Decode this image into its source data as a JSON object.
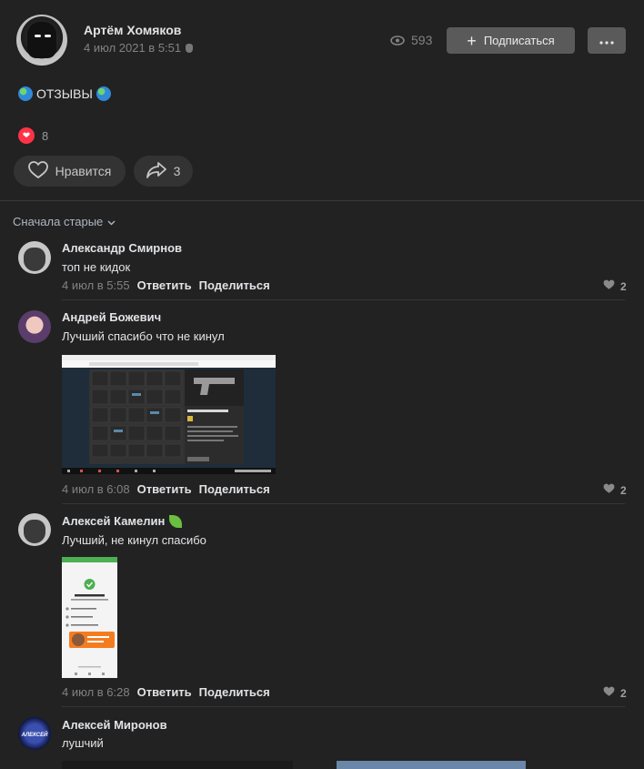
{
  "post": {
    "author": "Артём Хомяков",
    "date": "4 июл 2021 в 5:51",
    "views": "593",
    "subscribe_label": "Подписаться",
    "text": "ОТЗЫВЫ",
    "reactions_count": "8",
    "like_label": "Нравится",
    "shares_count": "3"
  },
  "comments_header": {
    "sort_label": "Сначала старые"
  },
  "comments": [
    {
      "author": "Александр Смирнов",
      "text": "топ не кидок",
      "time": "4 июл в 5:55",
      "reply": "Ответить",
      "share": "Поделиться",
      "likes": "2"
    },
    {
      "author": "Андрей Божевич",
      "text": "Лучший спасибо что не кинул",
      "time": "4 июл в 6:08",
      "reply": "Ответить",
      "share": "Поделиться",
      "likes": "2",
      "image_texts": {
        "item_title": "Desert Eagle | Mecenaj",
        "button": "Продать"
      }
    },
    {
      "author": "Алексей Камелин",
      "text": "Лучший, не кинул спасибо",
      "time": "4 июл в 6:28",
      "reply": "Ответить",
      "share": "Поделиться",
      "likes": "2",
      "image_texts": {
        "title": "Оплата отправлена"
      }
    },
    {
      "author": "Алексей Миронов",
      "text": "лушчий",
      "avatar_text": "АЛЕКСЕЙ"
    }
  ],
  "colors": {
    "background": "#222222",
    "button": "#5a5a5a",
    "heart": "#ff3347",
    "muted": "#828282"
  },
  "icons": [
    "eye-icon",
    "plus-icon",
    "more-icon",
    "globe-icon",
    "heart-icon",
    "share-icon",
    "chevron-down-icon",
    "apple-icon",
    "leaf-icon"
  ]
}
